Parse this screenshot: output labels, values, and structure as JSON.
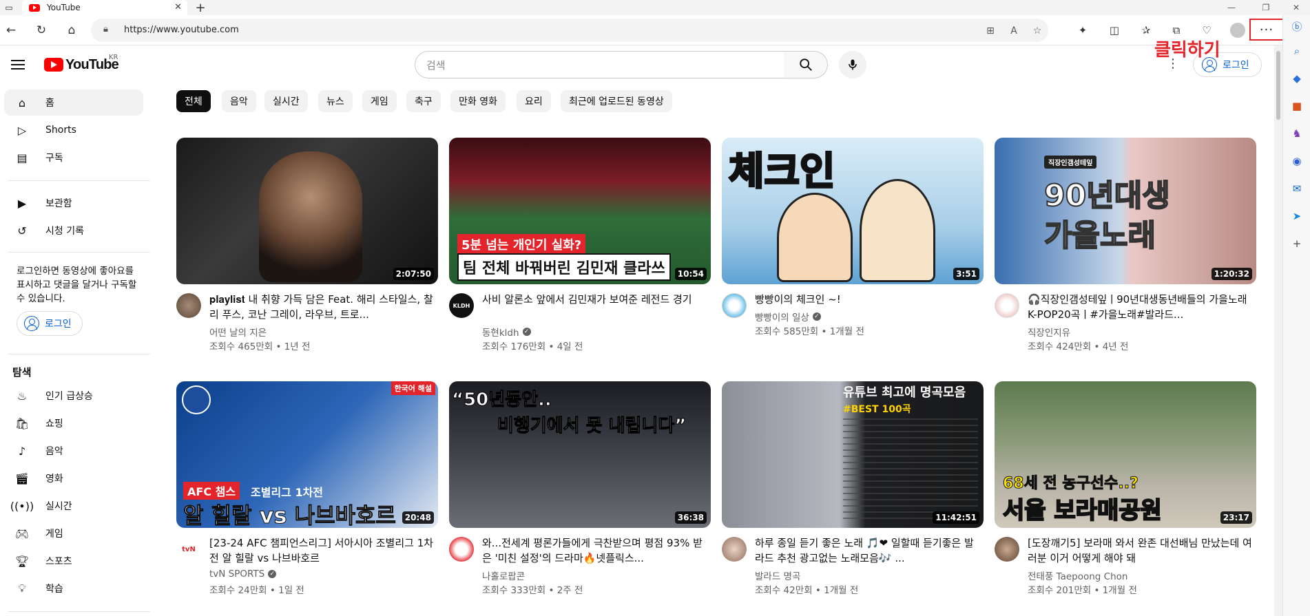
{
  "browser": {
    "tab_title": "YouTube",
    "url": "https://www.youtube.com",
    "annotation": "클릭하기",
    "more_label": "···"
  },
  "header": {
    "logo_text": "YouTube",
    "country_code": "KR",
    "search_placeholder": "검색",
    "login_label": "로그인"
  },
  "sidebar": {
    "main": [
      {
        "label": "홈",
        "icon": "home-icon"
      },
      {
        "label": "Shorts",
        "icon": "shorts-icon"
      },
      {
        "label": "구독",
        "icon": "subscriptions-icon"
      }
    ],
    "library": [
      {
        "label": "보관함",
        "icon": "library-icon"
      },
      {
        "label": "시청 기록",
        "icon": "history-icon"
      }
    ],
    "login_message": "로그인하면 동영상에 좋아요를 표시하고 댓글을 달거나 구독할 수 있습니다.",
    "login_label": "로그인",
    "explore_heading": "탐색",
    "explore": [
      {
        "label": "인기 급상승",
        "icon": "trending-icon"
      },
      {
        "label": "쇼핑",
        "icon": "shopping-icon"
      },
      {
        "label": "음악",
        "icon": "music-icon"
      },
      {
        "label": "영화",
        "icon": "movies-icon"
      },
      {
        "label": "실시간",
        "icon": "live-icon"
      },
      {
        "label": "게임",
        "icon": "gaming-icon"
      },
      {
        "label": "스포츠",
        "icon": "sports-icon"
      },
      {
        "label": "학습",
        "icon": "learning-icon"
      }
    ]
  },
  "chips": [
    "전체",
    "음악",
    "실시간",
    "뉴스",
    "게임",
    "축구",
    "만화 영화",
    "요리",
    "최근에 업로드된 동영상"
  ],
  "videos": [
    {
      "title": "𝐩𝐥𝐚𝐲𝐥𝐢𝐬𝐭 내 취향 가득 담은 Feat. 해리 스타일스, 찰리 푸스, 코난 그레이, 라우브, 트로...",
      "channel": "어떤 날의 지은",
      "verified": false,
      "views": "조회수 465만회",
      "age": "1년 전",
      "duration": "2:07:50",
      "overlay": ""
    },
    {
      "title": "사비 알론소 앞에서 김민재가 보여준 레전드 경기",
      "channel": "동현kldh",
      "verified": true,
      "views": "조회수 176만회",
      "age": "4일 전",
      "duration": "10:54",
      "overlay": "5분 넘는 개인기 실화?",
      "overlay2": "팀 전체 바꿔버린 김민재 클라쓰",
      "avatar_text": "KLDH"
    },
    {
      "title": "빵빵이의 체크인 ~!",
      "channel": "빵빵이의 일상",
      "verified": true,
      "views": "조회수 585만회",
      "age": "1개월 전",
      "duration": "3:51",
      "overlay": "체크인"
    },
    {
      "title": "🎧직장인갬성테잎ㅣ90년대생동년배들의 가을노래K-POP20곡ㅣ#가을노래#발라드...",
      "channel": "직장인지유",
      "verified": false,
      "views": "조회수 424만회",
      "age": "4년 전",
      "duration": "1:20:32",
      "overlay": "90년대생",
      "overlay2": "가을노래",
      "tag": "직장인갬성테잎"
    },
    {
      "title": "[23-24 AFC 챔피언스리그] 서아시아 조별리그 1차전 알 힐랄 vs 나브바호르",
      "channel": "tvN SPORTS",
      "verified": true,
      "views": "조회수 24만회",
      "age": "1일 전",
      "duration": "20:48",
      "overlay": "알 힐랄 vs 나브바호르",
      "overlay2": "AFC 챔스",
      "overlay3": "조별리그 1차전",
      "tag": "한국어 해설",
      "avatar_text": "tvN"
    },
    {
      "title": "와...전세계 평론가들에게 극찬받으며 평점 93% 받은 '미친 설정'의 드라마🔥넷플릭스...",
      "channel": "나홀로팝콘",
      "verified": false,
      "views": "조회수 333만회",
      "age": "2주 전",
      "duration": "36:38",
      "overlay": "“50년동안..",
      "overlay2": "비행기에서 못 내립니다”"
    },
    {
      "title": "하루 종일 듣기 좋은 노래 🎵❤ 일할때 듣기좋은 발라드 추천 광고없는 노래모음🎶 ...",
      "channel": "발라드 명곡",
      "verified": false,
      "views": "조회수 42만회",
      "age": "1개월 전",
      "duration": "11:42:51",
      "overlay": "유튜브 최고에 명곡모음",
      "overlay2": "#BEST 100곡"
    },
    {
      "title": "[도장깨기5] 보라매 와서 완존 대선배님 만났는데 여러분 이거 어떻게 해야 돼",
      "channel": "전태풍 Taepoong Chon",
      "verified": false,
      "views": "조회수 201만회",
      "age": "1개월 전",
      "duration": "23:17",
      "overlay": "68세 전 농구선수..?",
      "overlay2": "서울 보라매공원"
    }
  ],
  "colors": {
    "accent_red": "#ff0000",
    "link_blue": "#065fd4",
    "annotation_red": "#e3242b"
  }
}
